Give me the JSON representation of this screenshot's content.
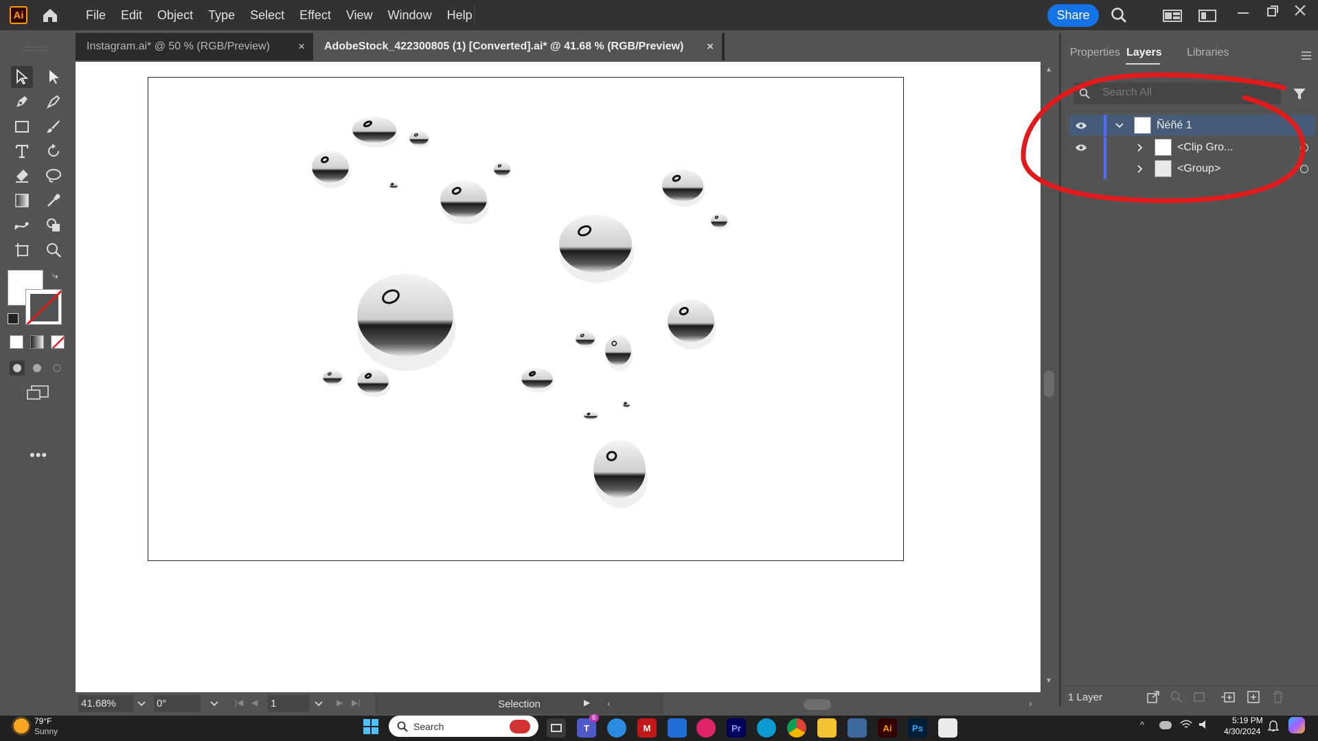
{
  "app": {
    "logo": "Ai",
    "accent": "#ff9a00",
    "share_label": "Share"
  },
  "menu": [
    "File",
    "Edit",
    "Object",
    "Type",
    "Select",
    "Effect",
    "View",
    "Window",
    "Help"
  ],
  "tabs": [
    {
      "label": "Instagram.ai* @ 50 % (RGB/Preview)",
      "close": "×"
    },
    {
      "label": "AdobeStock_422300805 (1) [Converted].ai* @ 41.68 % (RGB/Preview)",
      "close": "×"
    }
  ],
  "panel": {
    "tabs": [
      "Properties",
      "Layers",
      "Libraries"
    ],
    "search_placeholder": "Search All",
    "layers": [
      {
        "name": "Ñéñé 1",
        "visible": true
      },
      {
        "name": "<Clip Gro...",
        "visible": true
      },
      {
        "name": "<Group>",
        "visible": false
      }
    ],
    "footer": "1 Layer"
  },
  "status": {
    "zoom": "41.68%",
    "rotation": "0°",
    "artboard": "1",
    "tool": "Selection"
  },
  "taskbar": {
    "weather_temp": "79°F",
    "weather_desc": "Sunny",
    "search_placeholder": "Search",
    "time": "5:19 PM",
    "date": "4/30/2024",
    "teams_badge": "6",
    "ai_label": "Ai",
    "ps_label": "Ps",
    "pr_label": "Pr"
  },
  "overlay_color": "#e11b1b"
}
